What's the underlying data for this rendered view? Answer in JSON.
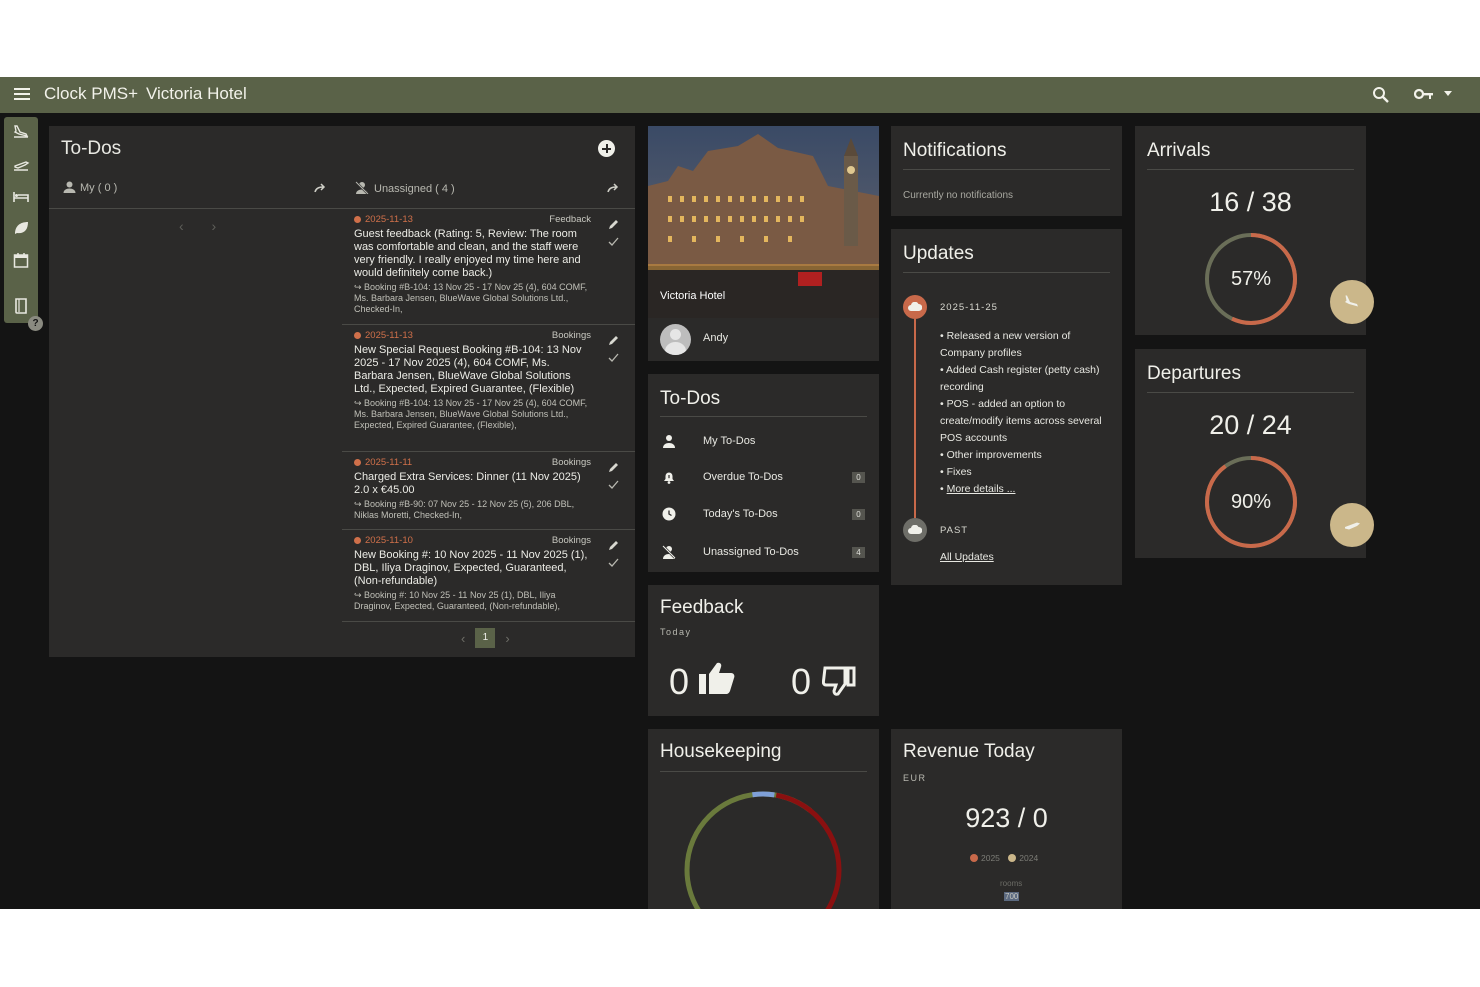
{
  "topbar": {
    "app_title": "Clock PMS+",
    "hotel": "Victoria Hotel"
  },
  "todos_panel": {
    "title": "To-Dos",
    "tab_my": "My ( 0 )",
    "tab_unassigned": "Unassigned ( 4 )",
    "items": [
      {
        "date": "2025-11-13",
        "category": "Feedback",
        "text": "Guest feedback (Rating: 5, Review: The room was comfortable and clean, and the staff were very friendly. I really enjoyed my time here and would definitely come back.)",
        "sub": "↪ Booking #B-104: 13 Nov 25 - 17 Nov 25 (4), 604 COMF, Ms. Barbara Jensen, BlueWave Global Solutions Ltd., Checked-In,"
      },
      {
        "date": "2025-11-13",
        "category": "Bookings",
        "text": "New Special Request Booking #B-104: 13 Nov 2025 - 17 Nov 2025 (4), 604 COMF, Ms. Barbara Jensen, BlueWave Global Solutions Ltd., Expected, Expired Guarantee, (Flexible)",
        "sub": "↪ Booking #B-104: 13 Nov 25 - 17 Nov 25 (4), 604 COMF, Ms. Barbara Jensen, BlueWave Global Solutions Ltd., Expected, Expired Guarantee, (Flexible),"
      },
      {
        "date": "2025-11-11",
        "category": "Bookings",
        "text": "Charged Extra Services: Dinner (11 Nov 2025) 2.0 x €45.00",
        "sub": "↪ Booking #B-90: 07 Nov 25 - 12 Nov 25 (5), 206 DBL, Niklas Moretti, Checked-In,"
      },
      {
        "date": "2025-11-10",
        "category": "Bookings",
        "text": "New Booking #: 10 Nov 2025 - 11 Nov 2025 (1), DBL, Iliya Draginov, Expected, Guaranteed, (Non-refundable)",
        "sub": "↪ Booking #: 10 Nov 25 - 11 Nov 25 (1), DBL, Iliya Draginov, Expected, Guaranteed, (Non-refundable),"
      }
    ],
    "page": "1"
  },
  "hotel_card": {
    "name": "Victoria Hotel",
    "user": "Andy"
  },
  "todos_widget": {
    "title": "To-Dos",
    "rows": [
      {
        "label": "My To-Dos",
        "count": ""
      },
      {
        "label": "Overdue To-Dos",
        "count": "0"
      },
      {
        "label": "Today's To-Dos",
        "count": "0"
      },
      {
        "label": "Unassigned To-Dos",
        "count": "4"
      }
    ]
  },
  "feedback": {
    "title": "Feedback",
    "period": "Today",
    "positive": "0",
    "negative": "0"
  },
  "housekeeping": {
    "title": "Housekeeping"
  },
  "notifications": {
    "title": "Notifications",
    "empty": "Currently no notifications"
  },
  "updates": {
    "title": "Updates",
    "date": "2025-11-25",
    "items": [
      "• Released a new version of Company profiles",
      "• Added Cash register (petty cash) recording",
      "• POS - added an option to create/modify items across several POS accounts",
      "• Other improvements",
      "• Fixes"
    ],
    "more": "More details ...",
    "past": "PAST",
    "all": "All Updates"
  },
  "revenue": {
    "title": "Revenue Today",
    "currency": "EUR",
    "amount": "923 / 0",
    "legend": [
      "2025",
      "2024"
    ],
    "axis_label": "rooms",
    "axis_value": "700"
  },
  "arrivals": {
    "title": "Arrivals",
    "ratio": "16 / 38",
    "percent": "57%",
    "progress": 0.57
  },
  "departures": {
    "title": "Departures",
    "ratio": "20 / 24",
    "percent": "90%",
    "progress": 0.9
  },
  "colors": {
    "topbar": "#5a6248",
    "accent": "#c8694a",
    "fab": "#cbb78a",
    "ring_track": "#6a6e58"
  }
}
